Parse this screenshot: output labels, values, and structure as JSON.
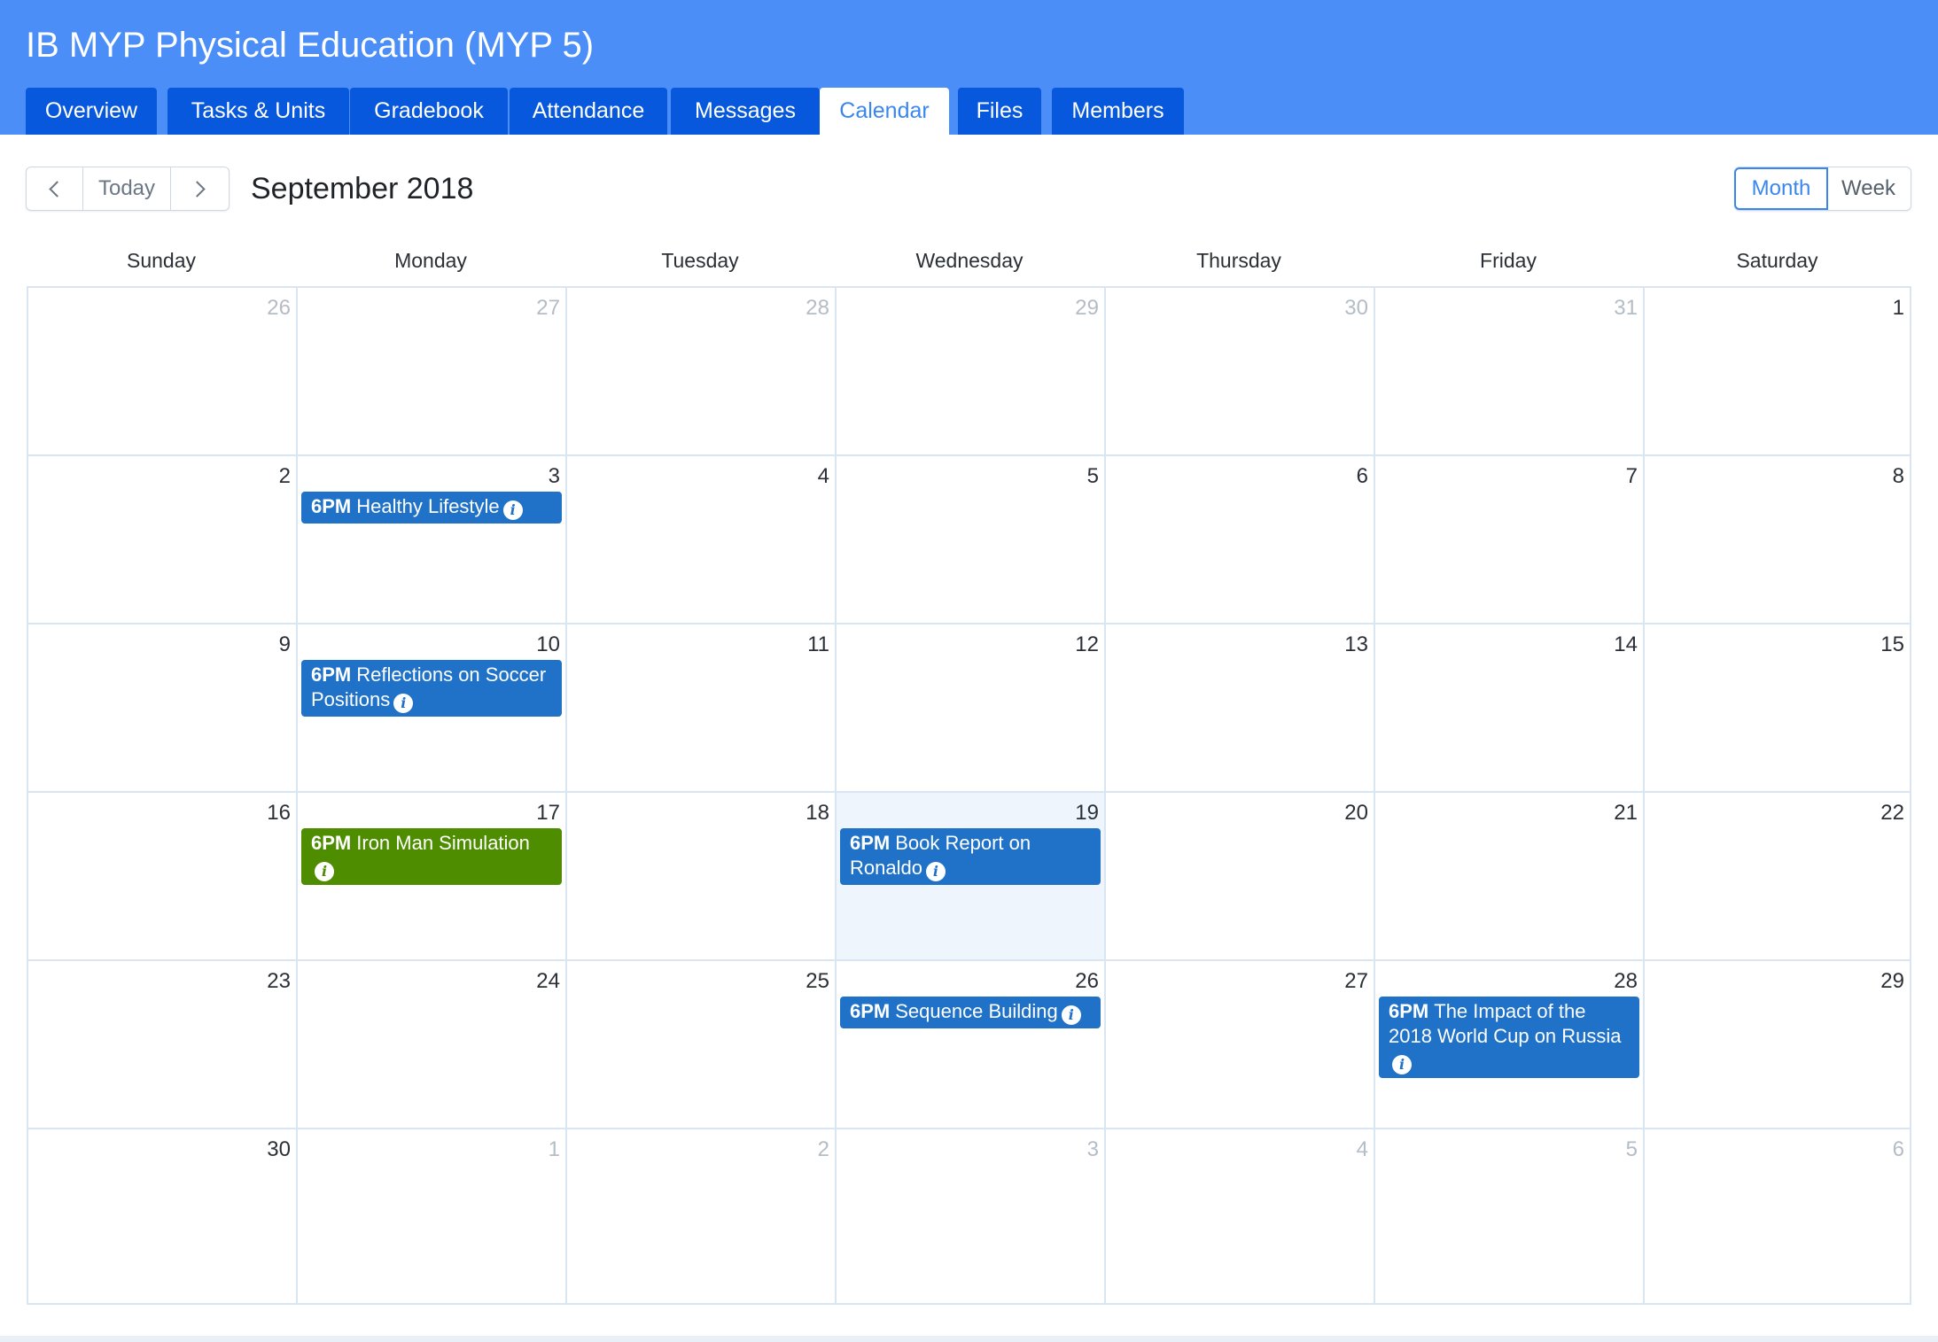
{
  "app": {
    "title": "IB MYP Physical Education (MYP 5)"
  },
  "tabs": [
    {
      "label": "Overview"
    },
    {
      "label": "Tasks & Units"
    },
    {
      "label": "Gradebook"
    },
    {
      "label": "Attendance"
    },
    {
      "label": "Messages"
    },
    {
      "label": "Calendar",
      "active": true
    },
    {
      "label": "Files"
    },
    {
      "label": "Members"
    }
  ],
  "toolbar": {
    "today_label": "Today",
    "month_title": "September 2018"
  },
  "views": [
    {
      "label": "Month",
      "active": true
    },
    {
      "label": "Week"
    }
  ],
  "weekdays": [
    "Sunday",
    "Monday",
    "Tuesday",
    "Wednesday",
    "Thursday",
    "Friday",
    "Saturday"
  ],
  "weeks": [
    [
      {
        "d": "26",
        "other": true
      },
      {
        "d": "27",
        "other": true
      },
      {
        "d": "28",
        "other": true
      },
      {
        "d": "29",
        "other": true
      },
      {
        "d": "30",
        "other": true
      },
      {
        "d": "31",
        "other": true
      },
      {
        "d": "1"
      }
    ],
    [
      {
        "d": "2"
      },
      {
        "d": "3"
      },
      {
        "d": "4"
      },
      {
        "d": "5"
      },
      {
        "d": "6"
      },
      {
        "d": "7"
      },
      {
        "d": "8"
      }
    ],
    [
      {
        "d": "9"
      },
      {
        "d": "10"
      },
      {
        "d": "11"
      },
      {
        "d": "12"
      },
      {
        "d": "13"
      },
      {
        "d": "14"
      },
      {
        "d": "15"
      }
    ],
    [
      {
        "d": "16"
      },
      {
        "d": "17"
      },
      {
        "d": "18"
      },
      {
        "d": "19",
        "today": true
      },
      {
        "d": "20"
      },
      {
        "d": "21"
      },
      {
        "d": "22"
      }
    ],
    [
      {
        "d": "23"
      },
      {
        "d": "24"
      },
      {
        "d": "25"
      },
      {
        "d": "26"
      },
      {
        "d": "27"
      },
      {
        "d": "28"
      },
      {
        "d": "29"
      }
    ],
    [
      {
        "d": "30"
      },
      {
        "d": "1",
        "other": true
      },
      {
        "d": "2",
        "other": true
      },
      {
        "d": "3",
        "other": true
      },
      {
        "d": "4",
        "other": true
      },
      {
        "d": "5",
        "other": true
      },
      {
        "d": "6",
        "other": true
      }
    ]
  ],
  "events": [
    {
      "week": 1,
      "day": 1,
      "time": "6PM",
      "title": "Healthy Lifestyle",
      "color": "#1f72c8"
    },
    {
      "week": 2,
      "day": 1,
      "time": "6PM",
      "title": "Reflections on Soccer Positions",
      "color": "#1f72c8"
    },
    {
      "week": 3,
      "day": 1,
      "time": "6PM",
      "title": "Iron Man Simulation",
      "color": "#4f8d00"
    },
    {
      "week": 3,
      "day": 3,
      "time": "6PM",
      "title": "Book Report on Ronaldo",
      "color": "#1f72c8"
    },
    {
      "week": 4,
      "day": 3,
      "time": "6PM",
      "title": "Sequence Building",
      "color": "#1f72c8"
    },
    {
      "week": 4,
      "day": 5,
      "time": "6PM",
      "title": "The Impact of the 2018 World Cup on Russia",
      "color": "#1f72c8"
    }
  ],
  "colors": {
    "header_bg": "#4b8ef8",
    "tab_bg": "#0758dc",
    "accent": "#3a86f0",
    "today_bg": "#eef5fd"
  }
}
